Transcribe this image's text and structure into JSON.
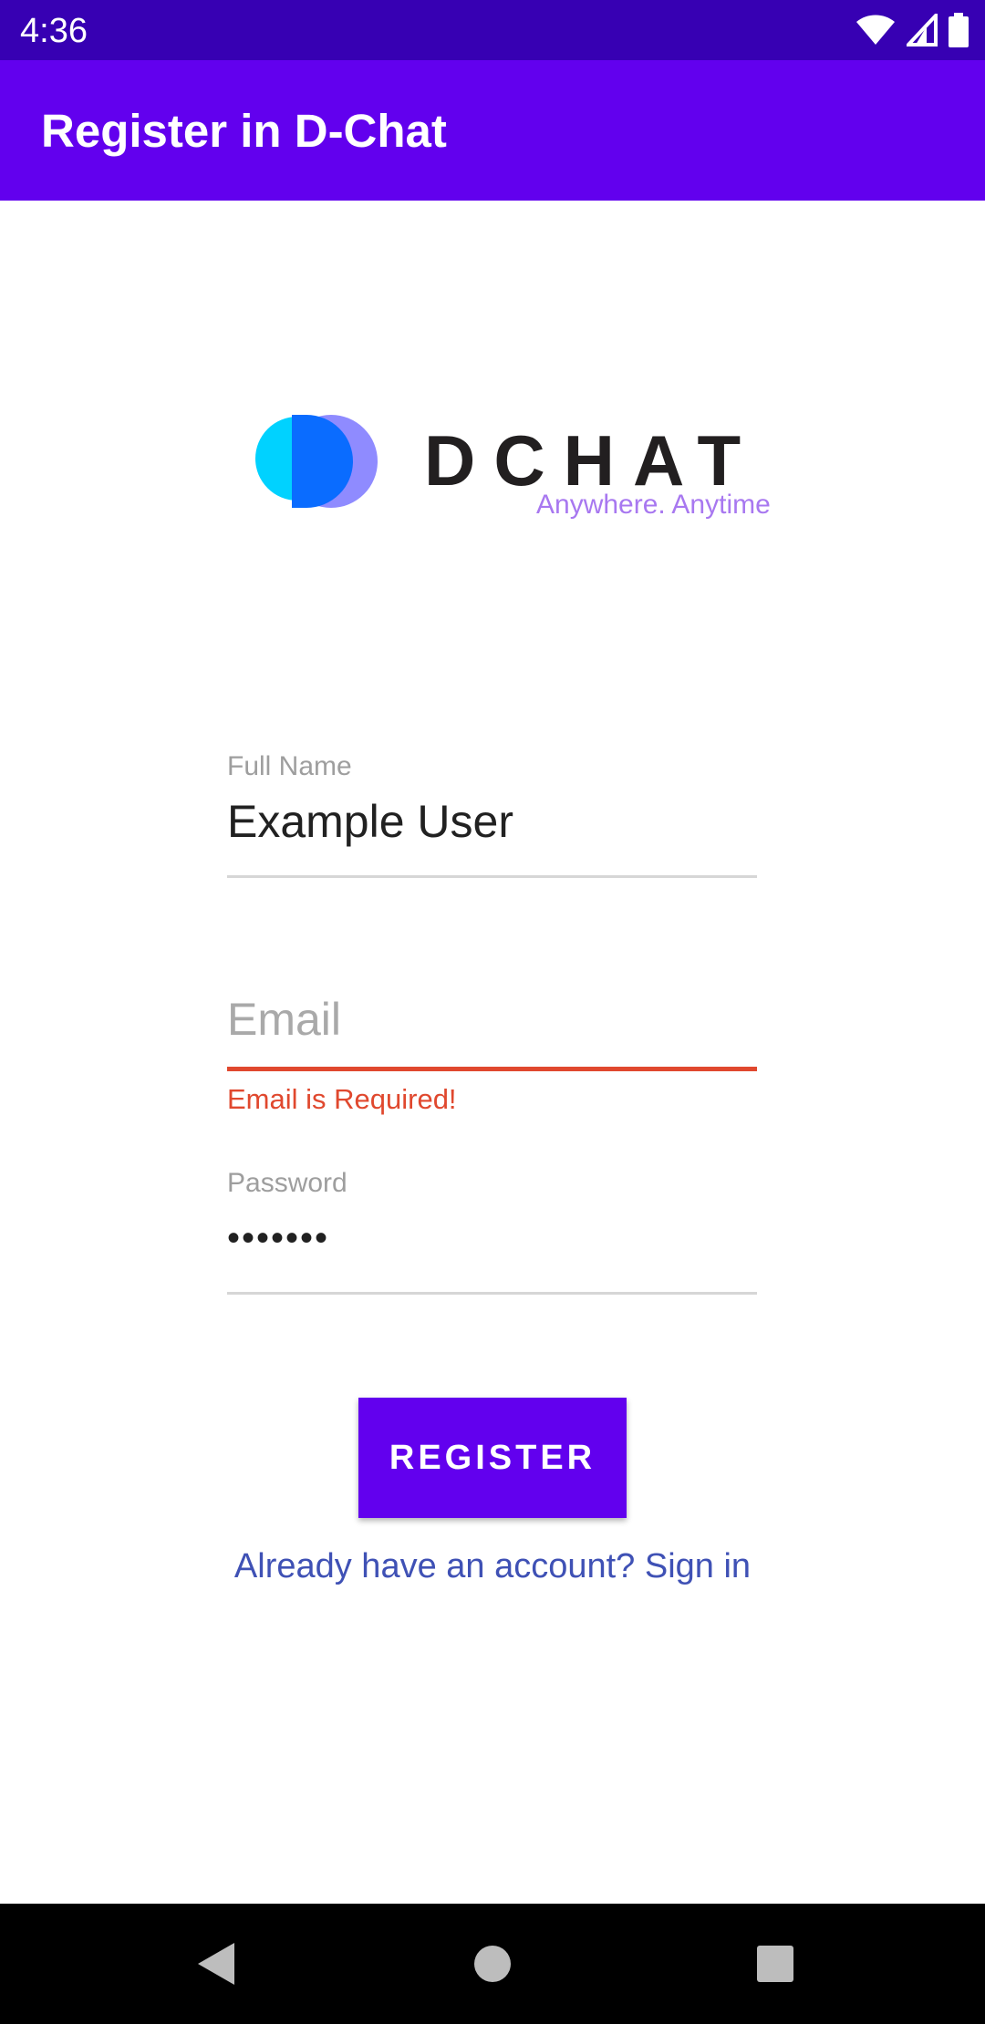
{
  "status_bar": {
    "time": "4:36",
    "icons": [
      "wifi-icon",
      "signal-icon",
      "battery-icon"
    ]
  },
  "app_bar": {
    "title": "Register in D-Chat"
  },
  "logo": {
    "wordmark": "DCHAT",
    "tagline": "Anywhere. Anytime"
  },
  "form": {
    "full_name": {
      "label": "Full Name",
      "value": "Example User"
    },
    "email": {
      "placeholder": "Email",
      "value": "",
      "error": "Email is Required!"
    },
    "password": {
      "label": "Password",
      "value": "•••••••"
    },
    "register_button": "REGISTER",
    "signin_link": "Already have an account? Sign in"
  },
  "nav_bar": {
    "buttons": [
      "back-icon",
      "home-icon",
      "recents-icon"
    ]
  },
  "colors": {
    "status_bar": "#3700b3",
    "primary": "#6200ee",
    "error": "#e0482e",
    "link": "#3f51b5",
    "logo_cyan": "#00d2ff",
    "logo_blue": "#0a6cff",
    "logo_lavender": "#8f8bff",
    "tagline": "#a878f0"
  }
}
